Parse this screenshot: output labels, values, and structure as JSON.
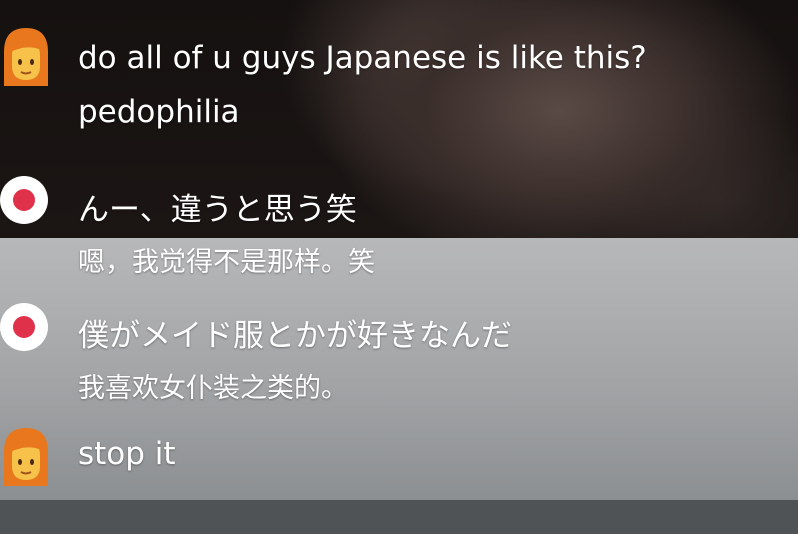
{
  "comments": [
    {
      "avatar": "woman-redhair-emoji-icon",
      "line1": "do all of u guys Japanese is like this?",
      "line2": "pedophilia"
    },
    {
      "avatar": "record-icon",
      "line1": "んー、違うと思う笑",
      "line2": "嗯，我觉得不是那样。笑"
    },
    {
      "avatar": "record-icon",
      "line1": "僕がメイド服とかが好きなんだ",
      "line2": "我喜欢女仆装之类的。"
    },
    {
      "avatar": "woman-redhair-emoji-icon",
      "line1": "stop it"
    }
  ],
  "colors": {
    "overlay": "#a8aaac",
    "record_red": "#e0314b",
    "avatar_hair": "#e8771d",
    "avatar_face": "#f6c24a"
  }
}
